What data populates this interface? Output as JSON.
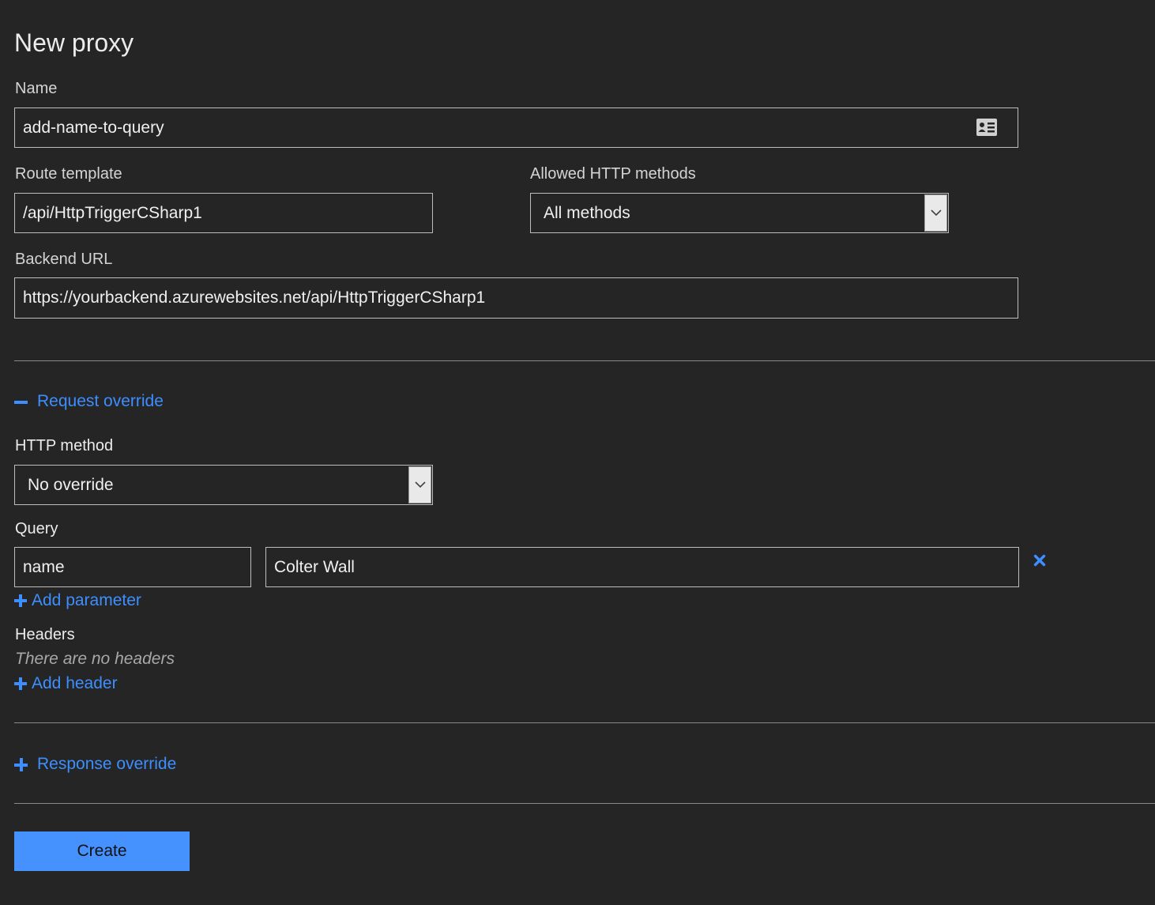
{
  "page": {
    "title": "New proxy"
  },
  "name_field": {
    "label": "Name",
    "value": "add-name-to-query"
  },
  "route_template": {
    "label": "Route template",
    "value": "/api/HttpTriggerCSharp1"
  },
  "allowed_methods": {
    "label": "Allowed HTTP methods",
    "selected": "All methods"
  },
  "backend_url": {
    "label": "Backend URL",
    "value": "https://yourbackend.azurewebsites.net/api/HttpTriggerCSharp1"
  },
  "request_override": {
    "label": "Request override",
    "expanded": true,
    "http_method": {
      "label": "HTTP method",
      "selected": "No override"
    },
    "query": {
      "label": "Query",
      "params": [
        {
          "key": "name",
          "value": "Colter Wall"
        }
      ],
      "add_label": "Add parameter"
    },
    "headers": {
      "label": "Headers",
      "empty_text": "There are no headers",
      "add_label": "Add header"
    }
  },
  "response_override": {
    "label": "Response override",
    "expanded": false
  },
  "actions": {
    "create_label": "Create"
  },
  "icons": {
    "name_field_icon": "contact-card-icon",
    "collapse": "minus-icon",
    "expand": "plus-icon",
    "remove": "close-x-icon",
    "dropdown": "chevron-down-icon"
  },
  "colors": {
    "background": "#252526",
    "accent": "#3d8fff",
    "button": "#4592ff",
    "border": "#bdbdbd"
  }
}
